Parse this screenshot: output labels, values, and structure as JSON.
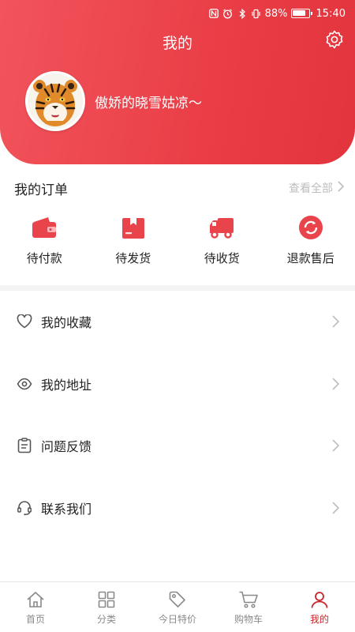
{
  "colors": {
    "brand": "#e83b44",
    "accent_text": "#c9252d",
    "muted": "#bdbdbd"
  },
  "status_bar": {
    "battery": "88%",
    "time": "15:40"
  },
  "header": {
    "title": "我的",
    "settings_icon": "gear-icon"
  },
  "user": {
    "name": "傲娇的晓雪姑凉～",
    "avatar_icon": "tiger-avatar"
  },
  "orders": {
    "title": "我的订单",
    "view_all": "查看全部",
    "items": [
      {
        "label": "待付款",
        "icon": "wallet-icon"
      },
      {
        "label": "待发货",
        "icon": "package-icon"
      },
      {
        "label": "待收货",
        "icon": "truck-icon"
      },
      {
        "label": "退款售后",
        "icon": "refund-icon"
      }
    ]
  },
  "menu": [
    {
      "label": "我的收藏",
      "icon": "heart-icon"
    },
    {
      "label": "我的地址",
      "icon": "location-icon"
    },
    {
      "label": "问题反馈",
      "icon": "feedback-icon"
    },
    {
      "label": "联系我们",
      "icon": "headset-icon"
    }
  ],
  "tabbar": {
    "active": "我的",
    "tabs": [
      {
        "label": "首页",
        "icon": "home-icon"
      },
      {
        "label": "分类",
        "icon": "category-icon"
      },
      {
        "label": "今日特价",
        "icon": "tag-icon"
      },
      {
        "label": "购物车",
        "icon": "cart-icon"
      },
      {
        "label": "我的",
        "icon": "user-icon"
      }
    ]
  }
}
